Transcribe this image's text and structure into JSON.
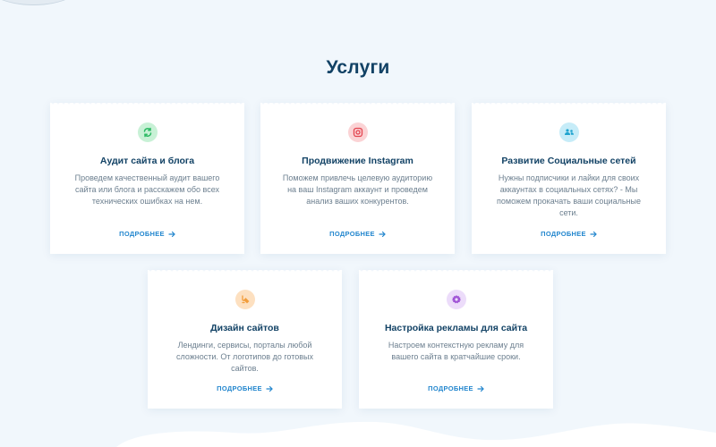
{
  "section": {
    "title": "Услуги"
  },
  "services": [
    {
      "title": "Аудит сайта и блога",
      "description": "Проведем качественный аудит вашего сайта или блога и расскажем обо всех технических ошибках на нем.",
      "link_label": "ПОДРОБНЕЕ",
      "icon": "refresh-icon",
      "icon_color": "#2dba64",
      "icon_bg": "#c8f1d6"
    },
    {
      "title": "Продвижение Instagram",
      "description": "Поможем привлечь целевую аудиторию на ваш Instagram аккаунт и проведем анализ ваших конкурентов.",
      "link_label": "ПОДРОБНЕЕ",
      "icon": "instagram-icon",
      "icon_color": "#e3444f",
      "icon_bg": "#fbd3d5"
    },
    {
      "title": "Развитие Социальные сетей",
      "description": "Нужны подписчики и лайки для своих аккаунтах в социальных сетях? - Мы поможем прокачать ваши социальные сети.",
      "link_label": "ПОДРОБНЕЕ",
      "icon": "users-icon",
      "icon_color": "#1fa3cf",
      "icon_bg": "#c6ecf8"
    },
    {
      "title": "Дизайн сайтов",
      "description": "Лендинги, сервисы, порталы любой сложности. От логотипов до готовых сайтов.",
      "link_label": "ПОДРОБНЕЕ",
      "icon": "pen-icon",
      "icon_color": "#f29d3b",
      "icon_bg": "#fde0c0"
    },
    {
      "title": "Настройка рекламы для сайта",
      "description": "Настроем контекстную рекламу для вашего сайта в кратчайшие сроки.",
      "link_label": "ПОДРОБНЕЕ",
      "icon": "gear-icon",
      "icon_color": "#a054d6",
      "icon_bg": "#ecdcfa"
    }
  ]
}
